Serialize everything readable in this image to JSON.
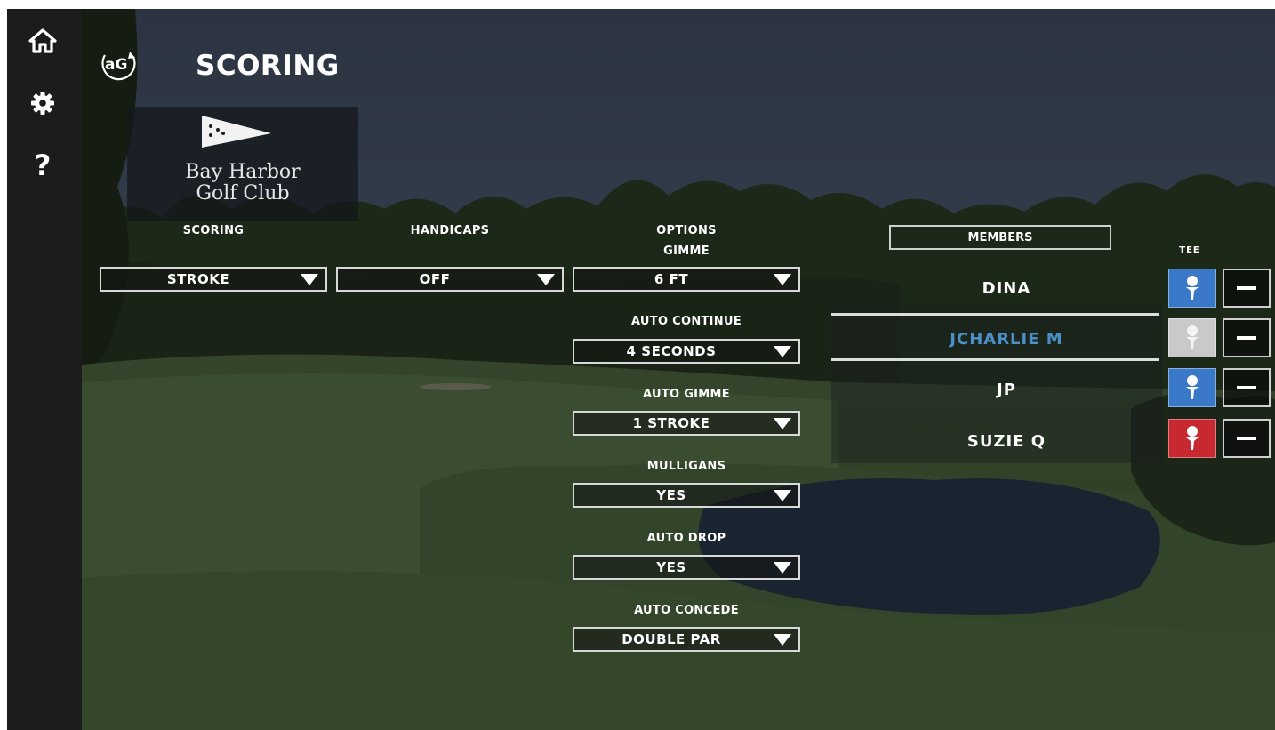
{
  "header": {
    "title": "SCORING",
    "logo_text": "aG"
  },
  "sidebar": {
    "items": [
      {
        "name": "home",
        "icon": "home-icon"
      },
      {
        "name": "settings",
        "icon": "gear-icon"
      },
      {
        "name": "help",
        "icon": "question-icon",
        "glyph": "?"
      }
    ]
  },
  "club": {
    "line1": "Bay Harbor",
    "line2": "Golf Club"
  },
  "scoring": {
    "label": "SCORING",
    "value": "STROKE"
  },
  "handicaps": {
    "label": "HANDICAPS",
    "value": "OFF"
  },
  "options": {
    "label": "OPTIONS",
    "gimme": {
      "label": "GIMME",
      "value": "6 FT"
    },
    "auto_continue": {
      "label": "AUTO CONTINUE",
      "value": "4 SECONDS"
    },
    "auto_gimme": {
      "label": "AUTO GIMME",
      "value": "1 STROKE"
    },
    "mulligans": {
      "label": "MULLIGANS",
      "value": "YES"
    },
    "auto_drop": {
      "label": "AUTO DROP",
      "value": "YES"
    },
    "auto_concede": {
      "label": "AUTO CONCEDE",
      "value": "DOUBLE PAR"
    }
  },
  "members": {
    "header": "MEMBERS",
    "tee_label": "TEE",
    "list": [
      {
        "name": "DINA",
        "tee_color": "#3a78c8",
        "selected": false
      },
      {
        "name": "JCHARLIE M",
        "tee_color": "#c9c9c9",
        "selected": true
      },
      {
        "name": "JP",
        "tee_color": "#3a78c8",
        "selected": false
      },
      {
        "name": "SUZIE Q",
        "tee_color": "#c8282f",
        "selected": false
      }
    ]
  },
  "colors": {
    "accent_blue": "#4a90c6",
    "tee_blue": "#3a78c8",
    "tee_white": "#c9c9c9",
    "tee_red": "#c8282f"
  }
}
